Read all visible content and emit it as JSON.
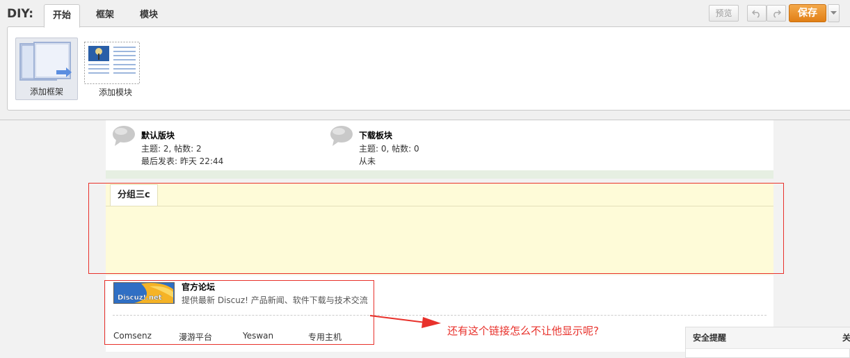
{
  "diy": {
    "label": "DIY:",
    "tabs": [
      {
        "label": "开始",
        "active": true
      },
      {
        "label": "框架",
        "active": false
      },
      {
        "label": "模块",
        "active": false
      }
    ],
    "tools": [
      {
        "label": "添加框架",
        "icon": "add-frame-icon"
      },
      {
        "label": "添加模块",
        "icon": "add-module-icon"
      }
    ],
    "preview_label": "预览",
    "undo_icon": "undo-icon",
    "redo_icon": "redo-icon",
    "save_label": "保存",
    "dropdown_icon": "chevron-down-icon",
    "accent": "#e8891d"
  },
  "forums": [
    {
      "name": "默认版块",
      "stats": "主题: 2, 帖数: 2",
      "last": "最后发表: 昨天 22:44",
      "icon": "speech-bubble-icon"
    },
    {
      "name": "下载板块",
      "stats": "主题: 0, 帖数: 0",
      "last": "从未",
      "icon": "speech-bubble-icon"
    }
  ],
  "group": {
    "title": "分组三c"
  },
  "links": {
    "featured": {
      "name": "官方论坛",
      "desc": "提供最新 Discuz! 产品新闻、软件下载与技术交流",
      "logo_text": "Discuz!.net"
    },
    "items": [
      "Comsenz",
      "漫游平台",
      "Yeswan",
      "专用主机"
    ]
  },
  "annotation": {
    "text": "还有这个链接怎么不让他显示呢?",
    "color": "#e8312b"
  },
  "security": {
    "title": "安全提醒",
    "close": "关"
  }
}
